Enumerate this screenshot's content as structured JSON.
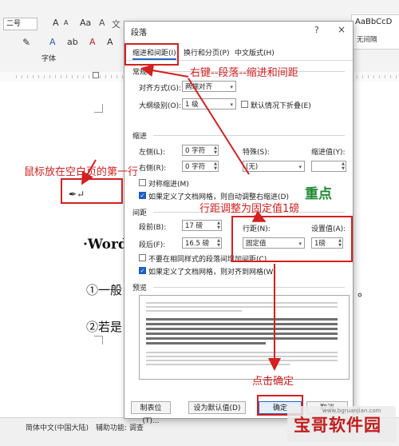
{
  "word": {
    "font_size_value": "二号",
    "style_sample": "AaBbCcD",
    "style_name": "无间隔",
    "group_label": "字体",
    "doc_lines": [
      "·Word",
      "①一般",
      "②若是"
    ],
    "cursor_mark": "↵",
    "status_language": "简体中文(中国大陆)",
    "status_accessibility": "辅助功能: 调查"
  },
  "dialog": {
    "title": "段落",
    "help": "?",
    "close": "×",
    "tabs": [
      "缩进和间距(I)",
      "换行和分页(P)",
      "中文版式(H)"
    ],
    "general": {
      "section": "常规",
      "alignment_label": "对齐方式(G):",
      "alignment_value": "两端对齐",
      "outline_label": "大纲级别(O):",
      "outline_value": "1 级",
      "collapsed_label": "默认情况下折叠(E)"
    },
    "indent": {
      "section": "缩进",
      "left_label": "左侧(L):",
      "left_value": "0 字符",
      "right_label": "右侧(R):",
      "right_value": "0 字符",
      "special_label": "特殊(S):",
      "special_value": "(无)",
      "by_label": "缩进值(Y):",
      "mirror_label": "对称缩进(M)",
      "auto_adjust_label": "如果定义了文档网格，则自动调整右缩进(D)"
    },
    "spacing": {
      "section": "间距",
      "before_label": "段前(B):",
      "before_value": "17 磅",
      "after_label": "段后(F):",
      "after_value": "16.5 磅",
      "line_spacing_label": "行距(N):",
      "line_spacing_value": "固定值",
      "at_label": "设置值(A):",
      "at_value": "1磅",
      "no_space_label": "不要在相同样式的段落间增加间距(C)",
      "snap_grid_label": "如果定义了文档网格，则对齐到网格(W)"
    },
    "preview": {
      "section": "预览"
    },
    "buttons": {
      "tabs": "制表位(T)...",
      "default": "设为默认值(D)",
      "ok": "确定",
      "cancel": "取消"
    }
  },
  "annotations": {
    "right_click": "右键--段落--缩进和间距",
    "cursor_hint": "鼠标放在空白页的第一行",
    "key_point": "重点",
    "line_spacing_hint": "行距调整为固定值1磅",
    "click_ok": "点击确定",
    "color": "#d42020",
    "green": "#1f8a33"
  },
  "watermark": {
    "text": "宝哥软件园",
    "url": "www.bgruanjian.com"
  }
}
